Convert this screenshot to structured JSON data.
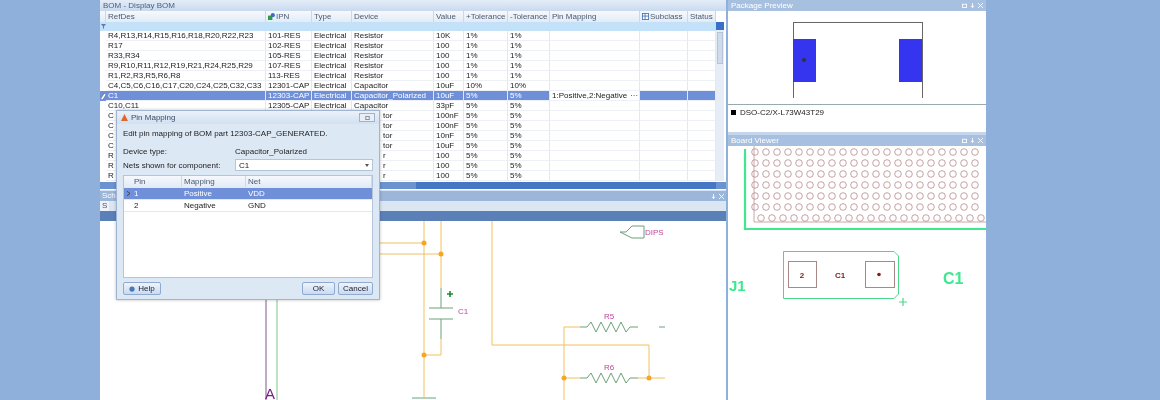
{
  "bom_panel": {
    "title": "BOM - Display BOM",
    "columns": [
      {
        "label": "RefDes",
        "kind": "plain"
      },
      {
        "label": "IPN",
        "kind": "parts"
      },
      {
        "label": "Type",
        "kind": "plain"
      },
      {
        "label": "Device",
        "kind": "plain"
      },
      {
        "label": "Value",
        "kind": "plain"
      },
      {
        "label": "+Tolerance",
        "kind": "plain"
      },
      {
        "label": "-Tolerance",
        "kind": "plain"
      },
      {
        "label": "Pin Mapping",
        "kind": "plain"
      },
      {
        "label": "Subclass",
        "kind": "grid"
      },
      {
        "label": "Status",
        "kind": "plain"
      }
    ],
    "rows": [
      {
        "kind": "full",
        "selected": false,
        "cells": [
          "R4,R13,R14,R15,R16,R18,R20,R22,R23",
          "101-RES",
          "Electrical",
          "Resistor",
          "10K",
          "1%",
          "1%"
        ]
      },
      {
        "kind": "full",
        "selected": false,
        "cells": [
          "R17",
          "102-RES",
          "Electrical",
          "Resistor",
          "100",
          "1%",
          "1%"
        ]
      },
      {
        "kind": "full",
        "selected": false,
        "cells": [
          "R33,R34",
          "105-RES",
          "Electrical",
          "Resistor",
          "100",
          "1%",
          "1%"
        ]
      },
      {
        "kind": "full",
        "selected": false,
        "cells": [
          "R9,R10,R11,R12,R19,R21,R24,R25,R29",
          "107-RES",
          "Electrical",
          "Resistor",
          "100",
          "1%",
          "1%"
        ]
      },
      {
        "kind": "full",
        "selected": false,
        "cells": [
          "R1,R2,R3,R5,R6,R8",
          "113-RES",
          "Electrical",
          "Resistor",
          "100",
          "1%",
          "1%"
        ]
      },
      {
        "kind": "full",
        "selected": false,
        "cells": [
          "C4,C5,C6,C16,C17,C20,C24,C25,C32,C33",
          "12301-CAP",
          "Electrical",
          "Capacitor",
          "10uF",
          "10%",
          "10%"
        ]
      },
      {
        "kind": "full",
        "selected": true,
        "cells": [
          "C1",
          "12303-CAP",
          "Electrical",
          "Capacitor_Polarized",
          "10uF",
          "5%",
          "5%"
        ],
        "pin_mapping": "1:Positive,2:Negative",
        "edit_button": "···"
      },
      {
        "kind": "full",
        "selected": false,
        "cells": [
          "C10,C11",
          "12305-CAP",
          "Electrical",
          "Capacitor",
          "33pF",
          "5%",
          "5%"
        ]
      },
      {
        "kind": "covered",
        "selected": false,
        "refdes_part": "C",
        "device_part": "tor",
        "cells": [
          "100nF",
          "5%",
          "5%"
        ]
      },
      {
        "kind": "covered",
        "selected": false,
        "refdes_part": "C",
        "device_part": "tor",
        "cells": [
          "100nF",
          "5%",
          "5%"
        ]
      },
      {
        "kind": "covered",
        "selected": false,
        "refdes_part": "C",
        "device_part": "tor",
        "cells": [
          "10nF",
          "5%",
          "5%"
        ]
      },
      {
        "kind": "covered",
        "selected": false,
        "refdes_part": "C",
        "device_part": "tor",
        "cells": [
          "10uF",
          "5%",
          "5%"
        ]
      },
      {
        "kind": "covered",
        "selected": false,
        "refdes_part": "R",
        "device_part": "r",
        "cells": [
          "100",
          "5%",
          "5%"
        ]
      },
      {
        "kind": "covered",
        "selected": false,
        "refdes_part": "R",
        "device_part": "r",
        "cells": [
          "100",
          "5%",
          "5%"
        ]
      },
      {
        "kind": "covered",
        "selected": false,
        "refdes_part": "R",
        "device_part": "r",
        "cells": [
          "100",
          "5%",
          "5%"
        ]
      }
    ]
  },
  "dialog": {
    "title": "Pin Mapping",
    "description": "Edit pin mapping of BOM part 12303-CAP_GENERATED.",
    "fields": [
      {
        "kind": "text",
        "label": "Device type:",
        "value": "Capacitor_Polarized"
      },
      {
        "kind": "dropdown",
        "label": "Nets shown for component:",
        "value": "C1"
      }
    ],
    "grid": {
      "columns": [
        "Pin",
        "Mapping",
        "Net"
      ],
      "rows": [
        {
          "selected": true,
          "cells": [
            "1",
            "Positive",
            "VDD"
          ]
        },
        {
          "selected": false,
          "cells": [
            "2",
            "Negative",
            "GND"
          ]
        }
      ]
    },
    "buttons": [
      {
        "kind": "help",
        "label": "Help"
      },
      {
        "kind": "ok",
        "label": "OK"
      },
      {
        "kind": "cancel",
        "label": "Cancel"
      }
    ]
  },
  "schematic_panel": {
    "title": "Sch",
    "tab": "S",
    "labels": {
      "capacitor": "C1",
      "resistor_top": "R5",
      "resistor_bottom": "R6",
      "connector": "DIPS",
      "net_marker": "A"
    }
  },
  "package_preview": {
    "title": "Package Preview",
    "legend": "DSO-C2/X-L73W43T29"
  },
  "board_viewer": {
    "title": "Board Viewer",
    "pad_label": "2",
    "footprint_label": "C1",
    "left_label": "J1",
    "right_label": "C1"
  }
}
